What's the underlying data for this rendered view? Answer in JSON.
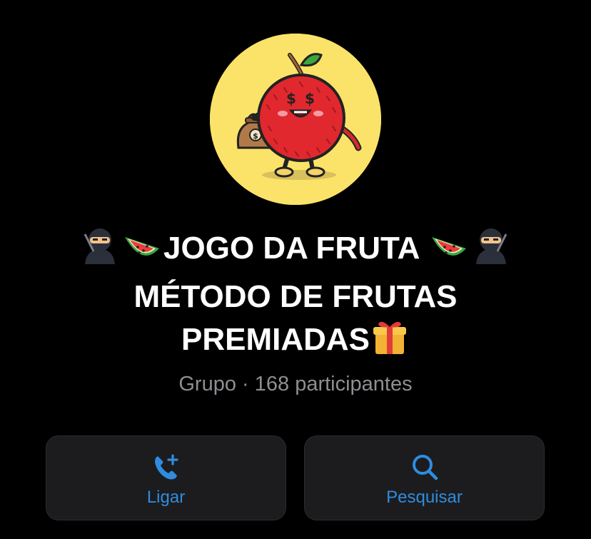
{
  "group": {
    "avatar_icon": "fruit-mascot-with-money-bag",
    "title_line1": "JOGO DA FRUTA",
    "title_line2": "MÉTODO DE FRUTAS",
    "title_line3": "PREMIADAS",
    "title_emojis": [
      "ninja-icon",
      "watermelon-icon",
      "watermelon-icon",
      "ninja-icon",
      "gift-icon"
    ],
    "subtitle": "Grupo · 168 participantes"
  },
  "actions": {
    "call_label": "Ligar",
    "call_icon": "phone-plus-icon",
    "search_label": "Pesquisar",
    "search_icon": "search-icon"
  },
  "colors": {
    "background": "#000000",
    "button_bg": "#1c1c1e",
    "accent": "#2f8ce0",
    "subtitle": "#8e8e93",
    "avatar_bg": "#fbe36a"
  }
}
